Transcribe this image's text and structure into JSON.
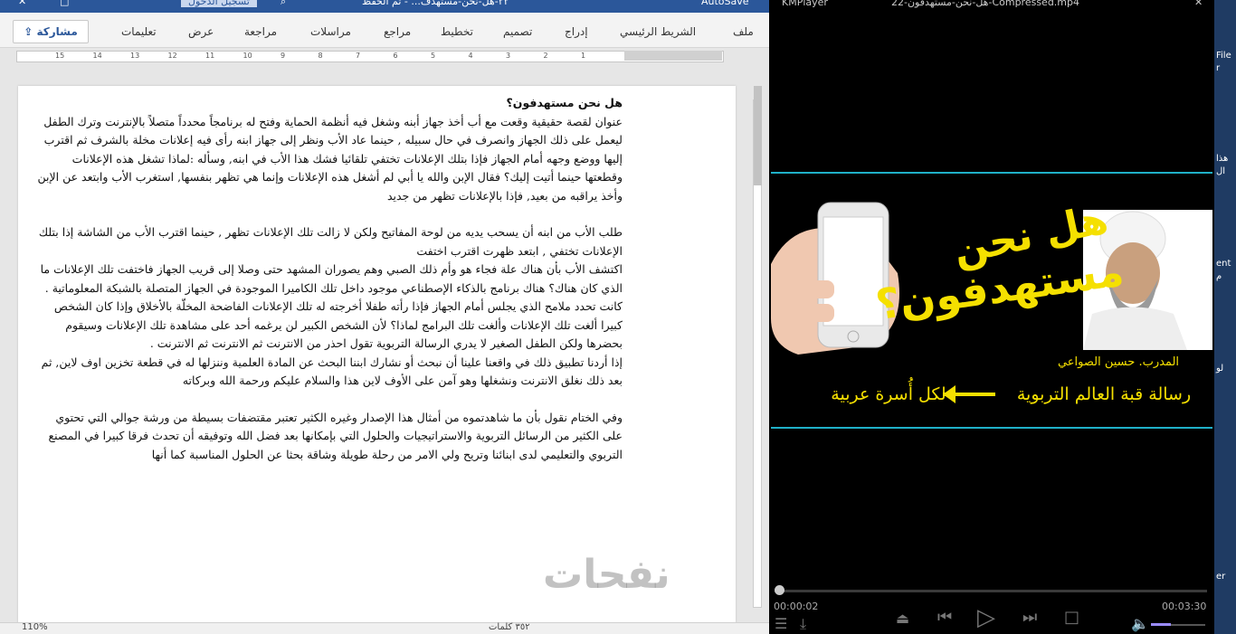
{
  "word": {
    "titlebar": {
      "sign_in": "تسجيل الدخول",
      "doc_title": "٢٢-هل-نحن-مستهدف...  -  تم الحفظ",
      "autosave": "AutoSave"
    },
    "ribbon": {
      "share": "مشاركة",
      "tabs": [
        "ملف",
        "الشريط الرئيسي",
        "إدراج",
        "تصميم",
        "تخطيط",
        "مراجع",
        "مراسلات",
        "مراجعة",
        "عرض",
        "تعليمات"
      ]
    },
    "ruler_numbers": [
      "15",
      "14",
      "13",
      "12",
      "11",
      "10",
      "9",
      "8",
      "7",
      "6",
      "5",
      "4",
      "3",
      "2",
      "1"
    ],
    "document": {
      "title": "هل نحن مستهدفون؟",
      "p1": "عنوان لقصة حقيقية وقعت مع أب أخذ جهاز أبنه وشغل فيه أنظمة الحماية وفتح له برنامجاً محدداً متصلاً بالإنترنت وترك الطفل ليعمل على ذلك الجهاز وانصرف في حال سبيله , حينما عاد الأب ونظر إلى جهاز ابنه رأى فيه إعلانات مخلة بالشرف ثم اقترب إليها ووضع وجهه أمام الجهاز فإذا بتلك الإعلانات تختفي تلقائيا فشك هذا الأب في ابنه, وسأله :لماذا تشغل هذه الإعلانات وقطعتها حينما أتيت إليك؟ فقال الإبن والله يا أبي لم أشغل هذه الإعلانات وإنما هي تظهر بنفسها, استغرب الأب وابتعد عن الإبن وأخذ يراقبه من بعيد, فإذا بالإعلانات تظهر من جديد",
      "p2": "طلب الأب من ابنه أن يسحب يديه من لوحة المفاتيح ولكن لا زالت تلك الإعلانات تظهر , حينما اقترب الأب من الشاشة إذا بتلك الإعلانات تختفي , ابتعد ظهرت اقترب اختفت",
      "p3": "اكتشف الأب بأن هناك علة فجاء هو وأم ذلك الصبي وهم يصوران المشهد حتى وصلا إلى قريب الجهاز فاختفت تلك الإعلانات ما الذي كان هناك؟ هناك برنامج بالذكاء الإصطناعي موجود داخل تلك الكاميرا الموجودة في الجهاز المتصلة بالشبكة المعلوماتية .",
      "p4": "كانت تحدد ملامح الذي يجلس أمام الجهاز فإذا رأته طفلا أخرجته له تلك الإعلانات الفاضحة المخلّة بالأخلاق وإذا كان الشخص كبيرا ألغت تلك الإعلانات وألغت تلك البرامج لماذا؟ لأن الشخص الكبير لن يرغمه أحد على مشاهدة تلك الإعلانات وسيقوم بحضرها ولكن الطفل الصغير لا يدري الرسالة التربوية تقول احذر من الانترنت ثم الانترنت ثم الانترنت .",
      "p5": "إذا أردنا تطبيق ذلك في واقعنا علينا أن نبحث أو نشارك ابننا البحث عن المادة العلمية وننزلها له في قطعة تخزين اوف لاين, ثم بعد ذلك نغلق الانترنت ونشغلها وهو آمن على الأوف لاين هذا والسلام عليكم ورحمة الله وبركاته",
      "p6": "وفي الختام نقول بأن ما شاهدتموه من أمثال هذا الإصدار وغيره الكثير تعتبر مقتضفات بسيطة من ورشة جوالي التي تحتوي على الكثير من الرسائل التربوية والاستراتيجيات والحلول التي بإمكانها بعد فضل الله وتوفيقه أن تحدث فرقا كبيرا في المصنع التربوي والتعليمي لدى ابنائنا وتريح ولي الامر من رحلة طويلة وشاقة بحثا عن الحلول المناسبة كما أنها"
    },
    "status": {
      "zoom": "110%",
      "words": "٣٥٢ كلمات"
    }
  },
  "player": {
    "title": "KMPlayer",
    "file": "22-هل-نحن-مستهدفون-Compressed.mp4",
    "video": {
      "headline_line1": "هل نحن",
      "headline_line2": "مستهدفون؟",
      "trainer": "المدرب. حسين الصواعي",
      "banner_left": "رسالة قبة العالم التربوية",
      "banner_right": "لكل أُسرة عربية"
    },
    "watermark": "نفحات",
    "time_current": "00:00:02",
    "time_total": "00:03:30",
    "progress": 0.01
  },
  "desktop": {
    "labels": [
      "File",
      "r",
      "هذا",
      "ال",
      "ent",
      "م",
      "لو",
      "er"
    ]
  },
  "colors": {
    "word_blue": "#2b579a",
    "video_yellow": "#f5e000",
    "frame_border": "#1fb0c8"
  }
}
